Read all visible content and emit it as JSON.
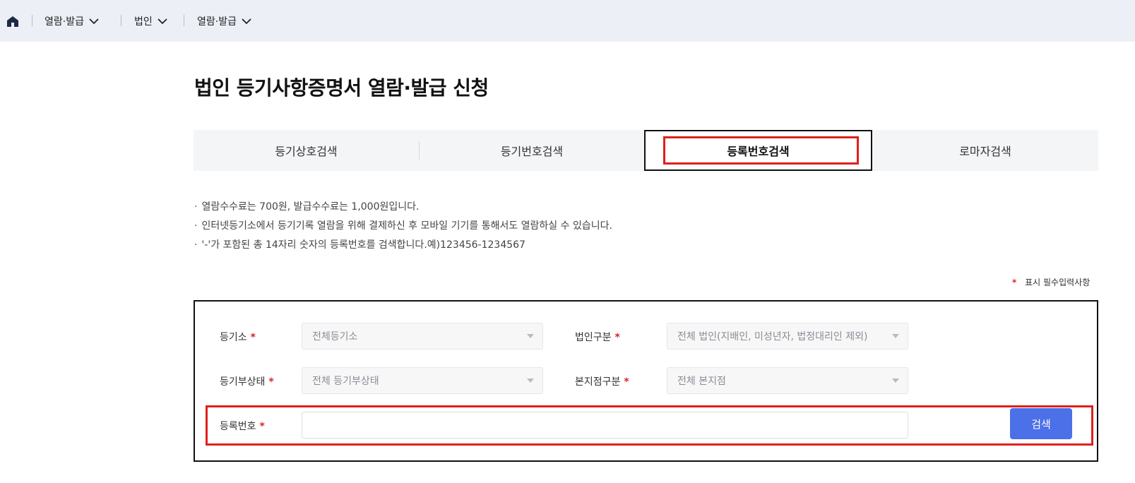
{
  "nav": {
    "home_icon": "home-icon",
    "items": [
      {
        "label": "열람·발급"
      },
      {
        "label": "법인"
      },
      {
        "label": "열람·발급"
      }
    ]
  },
  "page": {
    "title": "법인 등기사항증명서 열람·발급 신청"
  },
  "tabs": [
    {
      "label": "등기상호검색",
      "active": false
    },
    {
      "label": "등기번호검색",
      "active": false
    },
    {
      "label": "등록번호검색",
      "active": true
    },
    {
      "label": "로마자검색",
      "active": false
    }
  ],
  "notes": [
    "열람수수료는 700원, 발급수수료는 1,000원입니다.",
    "인터넷등기소에서 등기기록 열람을 위해 결제하신 후 모바일 기기를 통해서도 열람하실 수 있습니다.",
    "'-'가 포함된 총 14자리 숫자의 등록번호를 검색합니다.예)123456-1234567"
  ],
  "required_legend": {
    "star": "*",
    "text": "표시 필수입력사항"
  },
  "form": {
    "registry_office": {
      "label": "등기소",
      "value": "전체등기소"
    },
    "corp_type": {
      "label": "법인구분",
      "value": "전체 법인(지배인, 미성년자, 법정대리인 제외)"
    },
    "registry_status": {
      "label": "등기부상태",
      "value": "전체 등기부상태"
    },
    "branch_type": {
      "label": "본지점구분",
      "value": "전체 본지점"
    },
    "reg_number": {
      "label": "등록번호",
      "value": "",
      "placeholder": ""
    },
    "search_button": "검색",
    "required_mark": "*"
  },
  "colors": {
    "accent": "#4c70e8",
    "highlight": "#e0201b",
    "required": "#d8261f"
  }
}
